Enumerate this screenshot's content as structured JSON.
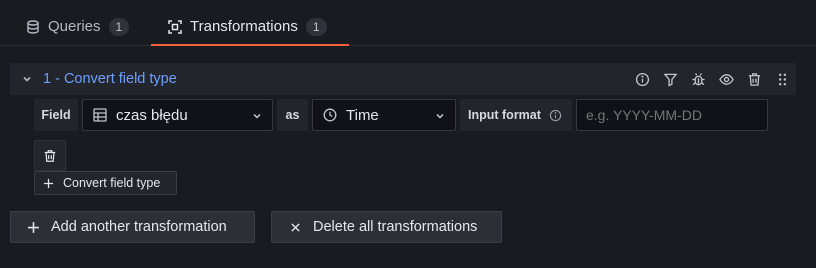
{
  "tabs": [
    {
      "label": "Queries",
      "count": "1",
      "icon": "database-icon"
    },
    {
      "label": "Transformations",
      "count": "1",
      "icon": "transform-icon",
      "active": true
    }
  ],
  "transformation": {
    "number": "1",
    "title": "1 - Convert field type",
    "header_icons": [
      "info-icon",
      "filter-icon",
      "debug-icon",
      "eye-icon",
      "trash-icon",
      "drag-handle-icon"
    ],
    "field_label": "Field",
    "field_value": "czas błędu",
    "as_label": "as",
    "type_value": "Time",
    "input_format_label": "Input format",
    "input_format_placeholder": "e.g. YYYY-MM-DD",
    "input_format_value": "",
    "tooltip": "Convert field type"
  },
  "actions": {
    "add": "Add another transformation",
    "delete_all": "Delete all transformations"
  },
  "colors": {
    "accent": "#f55f3e",
    "title_blue": "#6e9fff",
    "background": "#181b1f"
  }
}
